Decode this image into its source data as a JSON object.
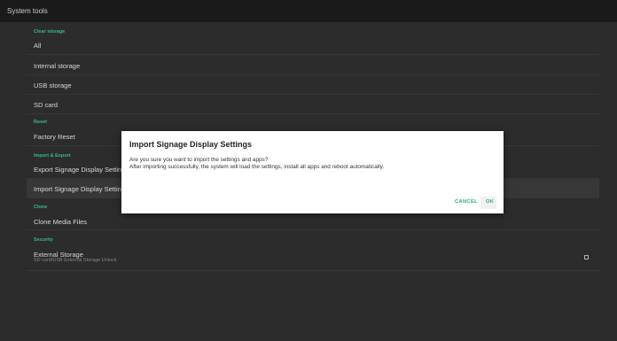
{
  "app": {
    "title": "System tools"
  },
  "sections": {
    "clear_storage": "Clear storage",
    "reset": "Reset",
    "import_export": "Import & Export",
    "clone": "Clone",
    "security": "Security"
  },
  "items": {
    "all": "All",
    "internal_storage": "Internal storage",
    "usb_storage": "USB storage",
    "sd_card": "SD card",
    "factory_reset": "Factory Reset",
    "export_settings": "Export Signage Display Settings",
    "import_settings": "Import Signage Display Settings",
    "clone_media": "Clone Media Files",
    "external_storage": "External Storage",
    "external_storage_sub": "SD card/USB External Storage Unlock"
  },
  "dialog": {
    "title": "Import Signage Display Settings",
    "line1": "Are you sure you want to import the settings and apps?",
    "line2": "After importing successfully, the system will load the settings, install all apps and reboot automatically.",
    "cancel_label": "CANCEL",
    "ok_label": "OK"
  },
  "colors": {
    "accent": "#3dc68f",
    "button": "#2fa88a"
  }
}
